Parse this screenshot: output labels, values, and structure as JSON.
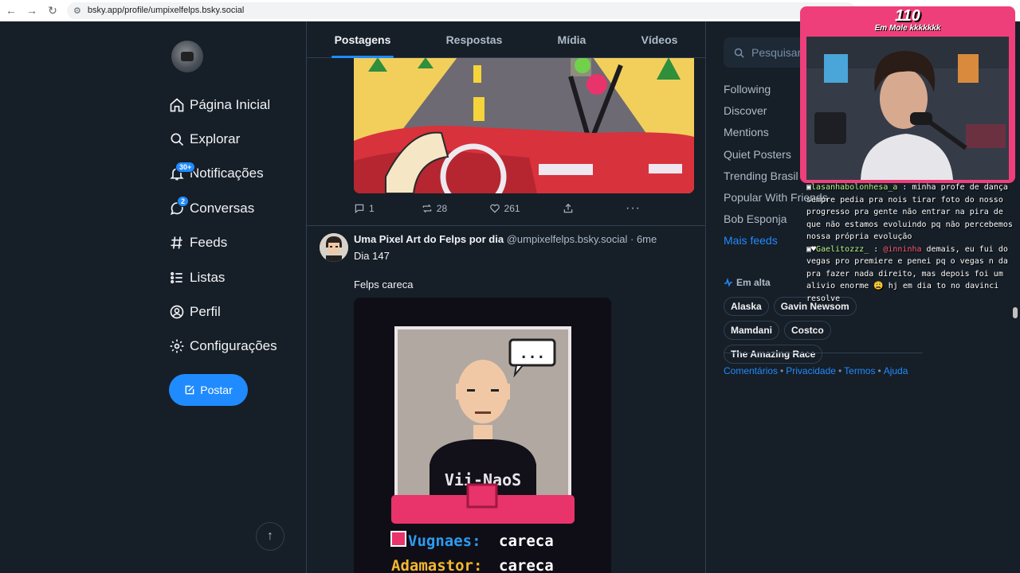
{
  "browser": {
    "url": "bsky.app/profile/umpixelfelps.bsky.social"
  },
  "sidebar": {
    "items": [
      {
        "label": "Página Inicial",
        "icon": "home-icon"
      },
      {
        "label": "Explorar",
        "icon": "search-icon"
      },
      {
        "label": "Notificações",
        "icon": "bell-icon",
        "badge": "30+"
      },
      {
        "label": "Conversas",
        "icon": "chat-icon",
        "badge": "2"
      },
      {
        "label": "Feeds",
        "icon": "hash-icon"
      },
      {
        "label": "Listas",
        "icon": "list-icon"
      },
      {
        "label": "Perfil",
        "icon": "user-icon"
      },
      {
        "label": "Configurações",
        "icon": "gear-icon"
      }
    ],
    "post_label": "Postar"
  },
  "tabs": [
    {
      "label": "Postagens",
      "active": true
    },
    {
      "label": "Respostas",
      "active": false
    },
    {
      "label": "Mídia",
      "active": false
    },
    {
      "label": "Vídeos",
      "active": false
    }
  ],
  "post1": {
    "replies": "1",
    "reposts": "28",
    "likes": "261"
  },
  "post2": {
    "author": "Uma Pixel Art do Felps por dia",
    "handle": "@umpixelfelps.bsky.social",
    "time": "· 6me",
    "text1": "Dia 147",
    "text2": "Felps careca",
    "image_text": {
      "speech": "...",
      "shirt": "Vii-NaoS",
      "line1_name": "Vugnaes:",
      "line1_value": "careca",
      "line2_name": "Adamastor:",
      "line2_value": "careca"
    }
  },
  "right": {
    "search_placeholder": "Pesquisar",
    "feeds": [
      "Following",
      "Discover",
      "Mentions",
      "Quiet Posters",
      "Trending Brasil",
      "Popular With Friends",
      "Bob Esponja"
    ],
    "more_feeds": "Mais feeds",
    "trending_title": "Em alta",
    "trending": [
      "Alaska",
      "Gavin Newsom",
      "Mamdani",
      "Costco",
      "The Amazing Race"
    ],
    "footer": [
      "Comentários",
      "Privacidade",
      "Termos",
      "Ajuda"
    ]
  },
  "stream": {
    "counter": "110",
    "label": "Em Mole kkkkkkk",
    "chat": [
      {
        "user": "lasanhabolonhesa_a",
        "sep": " : ",
        "text": "minha profe de dança sempre pedia pra nois tirar foto do nosso progresso pra gente não entrar na pira de que não estamos evoluindo pq não percebemos nossa própria evolução"
      },
      {
        "user": "Gaelitozzz_",
        "sep": " : ",
        "mention": "@inninha",
        "text": " demais, eu fui do vegas pro premiere e penei pq o vegas n da pra fazer nada direito, mas depois foi um alivio enorme 😩 hj em dia to no davinci resolve"
      }
    ]
  },
  "colors": {
    "background": "#161e27",
    "accent": "#208bfe",
    "border": "#2e4052",
    "muted": "#aebbc9",
    "stream_frame": "#ef3f7b"
  }
}
